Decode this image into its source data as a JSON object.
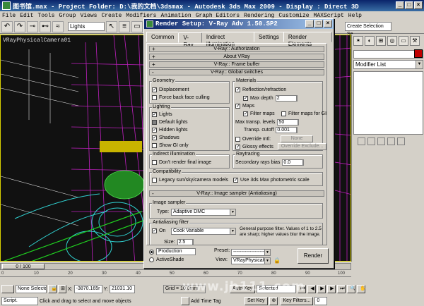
{
  "window": {
    "title": "图书馆.max   - Project Folder: D:\\我的文档\\3dsmax   - Autodesk 3ds Max  2009   - Display : Direct 3D"
  },
  "menu": [
    "File",
    "Edit",
    "Tools",
    "Group",
    "Views",
    "Create",
    "Modifiers",
    "Animation",
    "Graph Editors",
    "Rendering",
    "Customize",
    "MAXScript",
    "Help"
  ],
  "toolbar": {
    "reference_select": "Lights",
    "named_selection": "Create Selection Se"
  },
  "viewport": {
    "label": "VRayPhysicalCamera01"
  },
  "command_panel": {
    "modifier_list": "Modifier List"
  },
  "dialog": {
    "title": "Render Setup: V-Ray Adv 1.50.SP2",
    "tabs": [
      "Common",
      "V-Ray",
      "Indirect illumination",
      "Settings",
      "Render Elements"
    ],
    "active_tab": "V-Ray",
    "rollouts": {
      "authorization": "V-Ray:: Authorization",
      "about": "About VRay",
      "frame_buffer": "V-Ray:: Frame buffer",
      "global_switches": "V-Ray:: Global switches",
      "image_sampler": "V-Ray:: Image sampler (Antialiasing)"
    },
    "geometry": {
      "label": "Geometry",
      "displacement": "Displacement",
      "force_backface": "Force back face culling"
    },
    "lighting": {
      "label": "Lighting",
      "lights": "Lights",
      "default_lights": "Default lights",
      "hidden_lights": "Hidden lights",
      "shadows": "Shadows",
      "show_gi_only": "Show GI only"
    },
    "materials": {
      "label": "Materials",
      "reflection_refraction": "Reflection/refraction",
      "max_depth_label": "Max depth",
      "max_depth_value": "2",
      "maps": "Maps",
      "filter_maps": "Filter maps",
      "filter_maps_gi": "Filter maps for GI",
      "max_transp_label": "Max transp. levels",
      "max_transp_value": "50",
      "transp_cutoff_label": "Transp. cutoff",
      "transp_cutoff_value": "0.001",
      "override_mtl": "Override mtl:",
      "override_none": "None",
      "glossy_effects": "Glossy effects",
      "override_exclude": "Override Exclude..."
    },
    "indirect_illumination": {
      "label": "Indirect illumination",
      "dont_render_final": "Don't render final image"
    },
    "raytracing": {
      "label": "Raytracing",
      "secondary_bias_label": "Secondary rays bias",
      "secondary_bias_value": "0.0"
    },
    "compatibility": {
      "label": "Compatibility",
      "legacy_sun": "Legacy sun/sky/camera models",
      "use_photometric": "Use 3ds Max photometric scale"
    },
    "image_sampler": {
      "label": "Image sampler",
      "type_label": "Type:",
      "type_value": "Adaptive DMC"
    },
    "antialiasing": {
      "label": "Antialiasing filter",
      "on_label": "On",
      "filter_value": "Cook Variable",
      "description": "General purpose filter. Values of 1 to 2.5 are sharp; higher values blur the image.",
      "size_label": "Size:",
      "size_value": "2.5"
    },
    "bottom": {
      "production": "Production",
      "activeshade": "ActiveShade",
      "preset_label": "Preset:",
      "preset_value": "----------------------",
      "view_label": "View:",
      "view_value": "VRayPhysicalC",
      "render_button": "Render"
    }
  },
  "timeline": {
    "frame_counter": "0 / 100",
    "ticks": [
      "0",
      "10",
      "20",
      "30",
      "40",
      "50",
      "60",
      "70",
      "80",
      "90",
      "100"
    ]
  },
  "status": {
    "selection": "None Selecte",
    "x_label": "X:",
    "x_value": "-3870.165r",
    "y_label": "Y:",
    "y_value": "21031.10",
    "grid": "Grid = 10.0mm",
    "auto_key": "Auto Key",
    "key_mode": "Selected",
    "set_key": "Set Key",
    "key_filters": "Key Filters...",
    "frame": "0",
    "prompt": "Click and drag to select and move objects",
    "add_time_tag": "Add Time Tag",
    "script": "Script."
  },
  "watermark": "www.jb111.com",
  "colors": {
    "titlebar": "#0a246a",
    "viewport_bg": "#111111",
    "wire_magenta": "#c020c0",
    "wire_green": "#30c030",
    "wire_cyan": "#20c0c0"
  }
}
